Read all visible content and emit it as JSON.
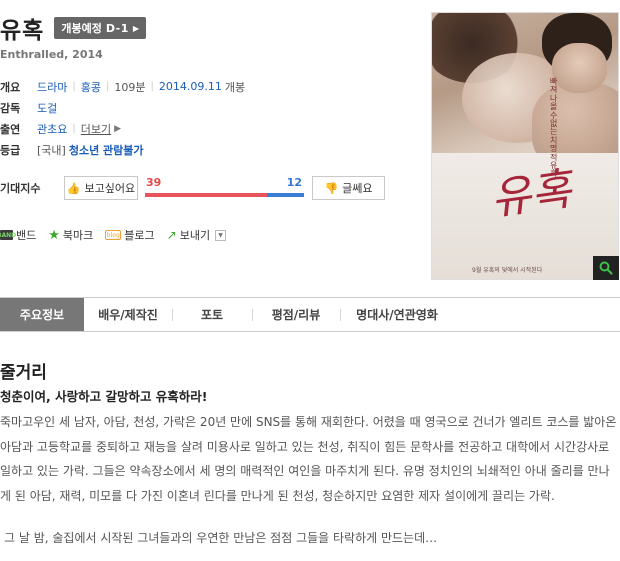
{
  "movie": {
    "title": "유혹",
    "badge_label": "개봉예정",
    "badge_dday": "D-1",
    "original_title": "Enthralled, 2014"
  },
  "info": {
    "overview_label": "개요",
    "genre": "드라마",
    "country": "홍콩",
    "runtime": "109분",
    "release_date": "2014.09.11",
    "release_suffix": "개봉",
    "director_label": "감독",
    "director": "도걸",
    "cast_label": "출연",
    "cast": "관초요",
    "cast_more": "더보기",
    "grade_label": "등급",
    "grade_prefix": "[국내]",
    "grade": "청소년 관람불가"
  },
  "expect": {
    "label": "기대지수",
    "like_label": "보고싶어요",
    "dislike_label": "글쎄요",
    "like_count": "39",
    "dislike_count": "12",
    "like_ratio": 0.765
  },
  "share": {
    "band": "밴드",
    "bookmark": "북마크",
    "blog": "블로그",
    "send": "보내기",
    "band_icon_text": "BAND",
    "blog_icon_text": "blog"
  },
  "poster": {
    "calligraphy": "유혹",
    "tagline": "빠져나올 수 없는 치명적 유혹",
    "bottom_text": "9월 유혹의 덫에서 시작된다"
  },
  "tabs": [
    {
      "label": "주요정보"
    },
    {
      "label": "배우/제작진"
    },
    {
      "label": "포토"
    },
    {
      "label": "평점/리뷰"
    },
    {
      "label": "명대사/연관영화"
    }
  ],
  "synopsis": {
    "heading": "줄거리",
    "tagline": "청춘이여, 사랑하고 갈망하고 유혹하라!",
    "body": "죽마고우인 세 남자, 아담, 천성, 가락은 20년 만에 SNS를 통해 재회한다. 어렸을 때 영국으로 건너가 엘리트 코스를 밟아온 아담과 고등학교를 중퇴하고 재능을 살려 미용사로 일하고 있는 천성, 취직이 힘든 문학사를 전공하고 대학에서 시간강사로 일하고 있는 가락. 그들은 약속장소에서 세 명의 매력적인 여인을 마주치게 된다. 유명 정치인의 뇌쇄적인 아내 줄리를 만나게 된 아담, 재력, 미모를 다 가진 이혼녀 린다를 만나게 된 천성, 청순하지만 요염한 제자 설이에게 끌리는 가락.",
    "body2": "그 날 밤, 술집에서 시작된 그녀들과의 우연한 만남은 점점 그들을 타락하게 만드는데…"
  }
}
